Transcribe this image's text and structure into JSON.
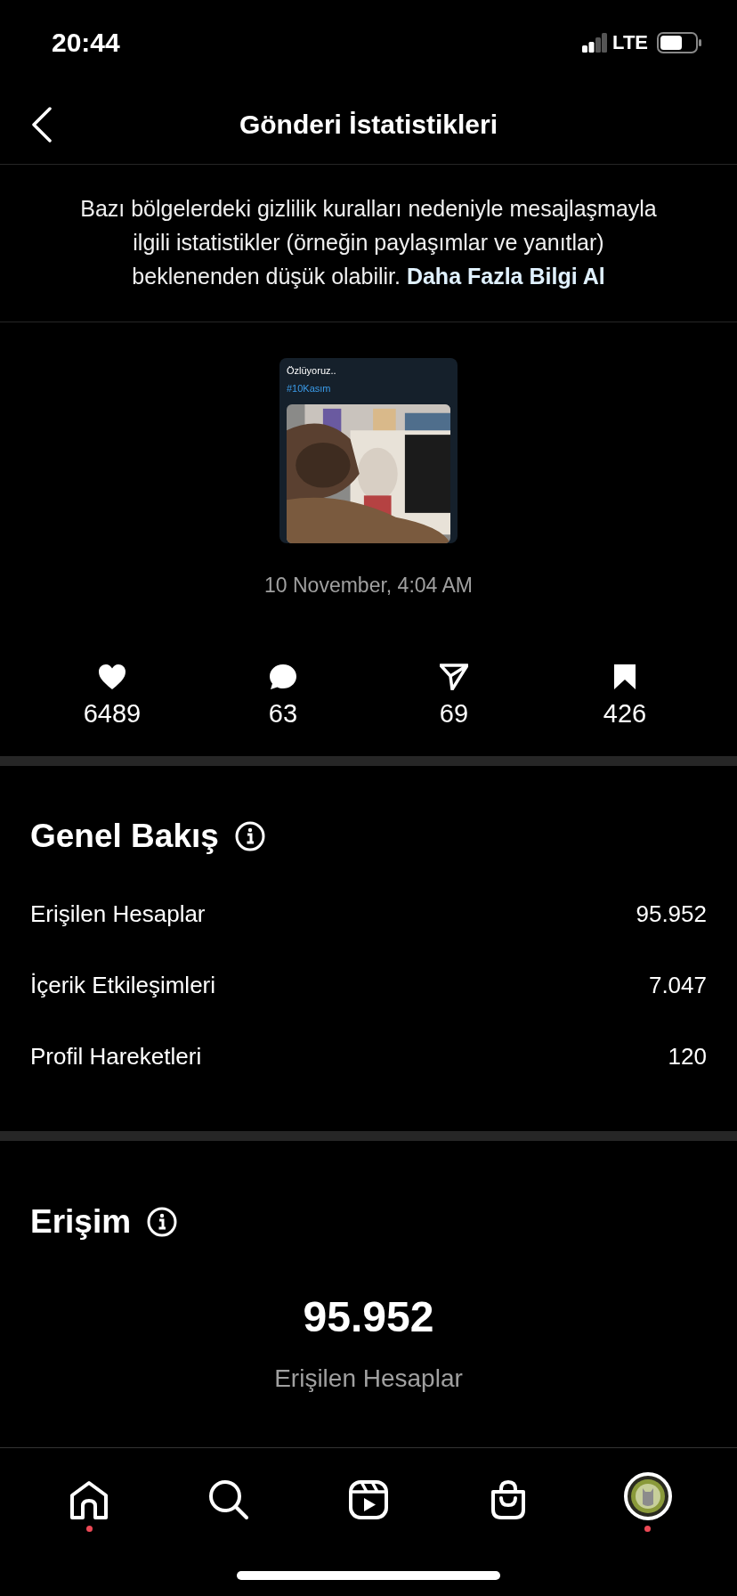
{
  "status_bar": {
    "time": "20:44",
    "network": "LTE"
  },
  "header": {
    "title": "Gönderi İstatistikleri"
  },
  "notice": {
    "text": "Bazı bölgelerdeki gizlilik kuralları nedeniyle mesajlaşmayla ilgili istatistikler (örneğin paylaşımlar ve yanıtlar) beklenenden düşük olabilir.",
    "link": "Daha Fazla Bilgi Al"
  },
  "post": {
    "caption": "Özlüyoruz..",
    "hashtag": "#10Kasım",
    "date": "10 November, 4:04 AM"
  },
  "stats": [
    {
      "kind": "likes",
      "value": "6489"
    },
    {
      "kind": "comments",
      "value": "63"
    },
    {
      "kind": "shares",
      "value": "69"
    },
    {
      "kind": "saves",
      "value": "426"
    }
  ],
  "overview": {
    "title": "Genel Bakış",
    "rows": [
      {
        "label": "Erişilen Hesaplar",
        "value": "95.952"
      },
      {
        "label": "İçerik Etkileşimleri",
        "value": "7.047"
      },
      {
        "label": "Profil Hareketleri",
        "value": "120"
      }
    ]
  },
  "reach": {
    "title": "Erişim",
    "value": "95.952",
    "label": "Erişilen Hesaplar"
  },
  "nav": [
    {
      "kind": "home",
      "badge": true
    },
    {
      "kind": "search",
      "badge": false
    },
    {
      "kind": "reels",
      "badge": false
    },
    {
      "kind": "shop",
      "badge": false
    },
    {
      "kind": "profile",
      "badge": true
    }
  ]
}
